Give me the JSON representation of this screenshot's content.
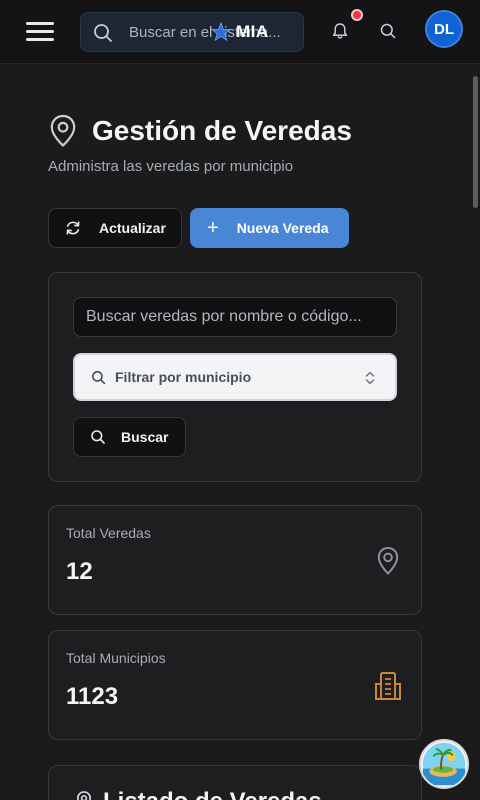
{
  "header": {
    "search_placeholder": "Buscar en el sistema...",
    "brand": "MIA",
    "avatar_initials": "DL",
    "notification_color": "#e53946"
  },
  "page": {
    "title": "Gestión de Veredas",
    "subtitle": "Administra las veredas por municipio"
  },
  "actions": {
    "refresh_label": "Actualizar",
    "new_label": "Nueva Vereda"
  },
  "filters": {
    "search_placeholder": "Buscar veredas por nombre o código...",
    "municipio_placeholder": "Filtrar por municipio",
    "search_button": "Buscar"
  },
  "stats": [
    {
      "label": "Total Veredas",
      "value": "12",
      "icon": "map-pin-icon",
      "icon_color": "#8c919a"
    },
    {
      "label": "Total Municipios",
      "value": "1123",
      "icon": "building-icon",
      "icon_color": "#c8873a"
    }
  ],
  "list": {
    "title": "Listado de Veredas"
  },
  "colors": {
    "accent": "#4a86d6",
    "background": "#1b1b1c",
    "card": "#1e1e20"
  }
}
